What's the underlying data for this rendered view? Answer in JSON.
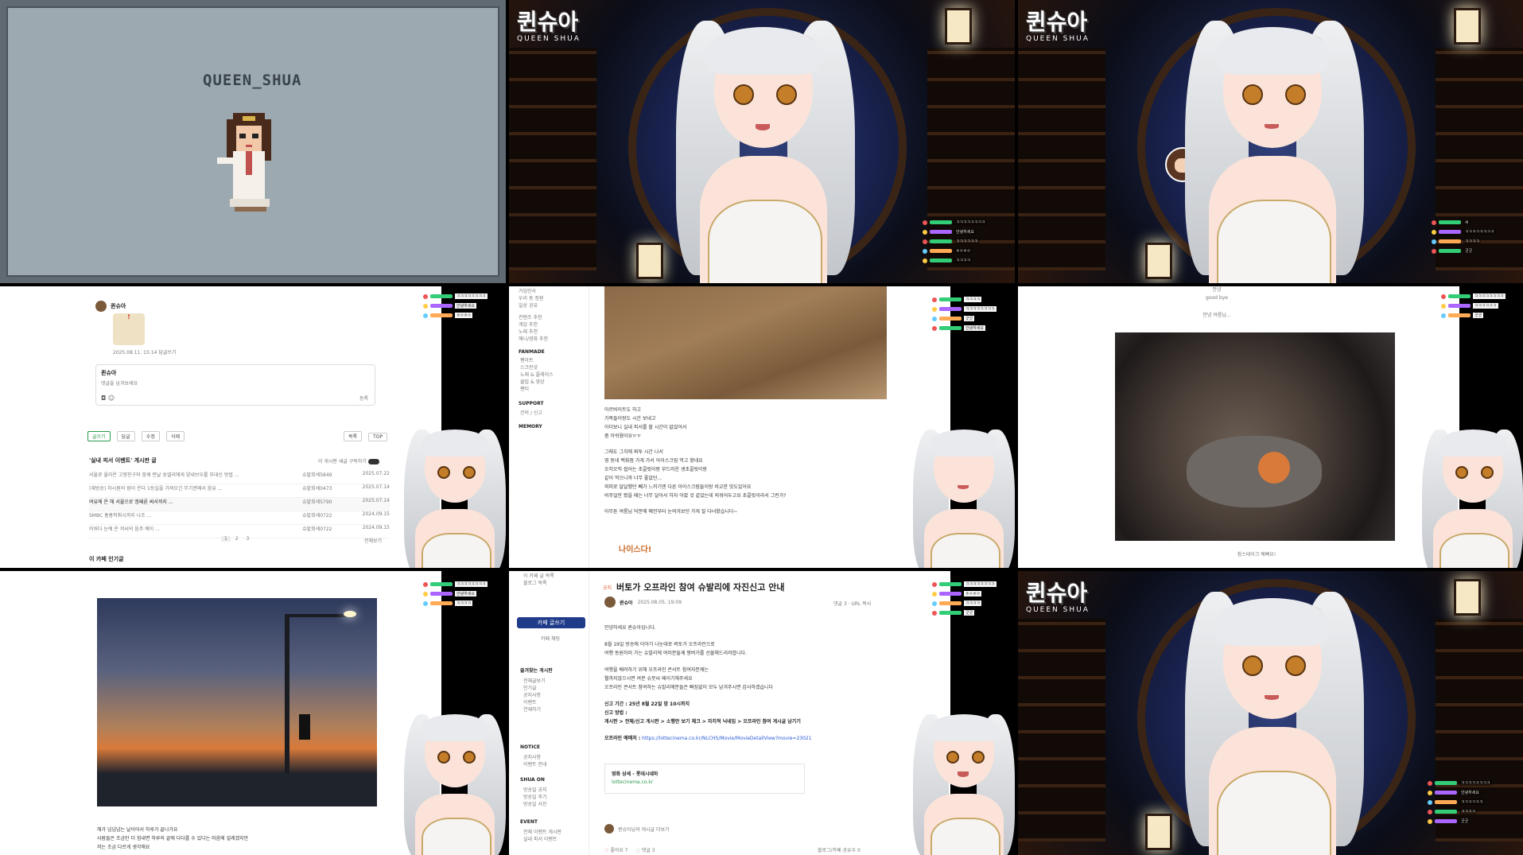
{
  "pixel_tile": {
    "name": "QUEEN_SHUA"
  },
  "stream": {
    "logo_korean": "퀸슈아",
    "logo_english": "QUEEN SHUA"
  },
  "chat_overlay": {
    "messages": [
      "ㅋㅋㅋㅋㅋㅋㅋㅋ",
      "씨",
      "안녕하세요",
      "ㅋㅋㅋㅋㅋㅋ",
      "ㅎㅇㅎㅇ",
      "ㅋㅋㅋㅋ",
      "굿굿"
    ]
  },
  "cafe_post": {
    "commenter": "퀸슈아",
    "comment_date": "2025.08.11. 15:14",
    "reply_label": "답글쓰기",
    "comment_box_name": "퀸슈아",
    "comment_placeholder": "댓글을 남겨보세요",
    "submit_label": "등록",
    "action_buttons": [
      "글쓰기",
      "답글",
      "수정",
      "삭제"
    ],
    "list_button": "목록",
    "top_button": "TOP",
    "board_title": "'실내 피서 이벤트' 게시판 글",
    "board_toggle": "이 게시판 새글 구독하기",
    "popular_title": "이 카페 인기글",
    "posts": [
      {
        "title": "서울로 올라온 고향친구와 함께 찐날 숭엘리에게 양내브우를 부대신 방법 ...",
        "author": "슈밭희세5849",
        "date": "2025.07.22"
      },
      {
        "title": "(재방송) 하시원의 잠이 온다 1등실을 가져오긴 무기권에서 음유 ...",
        "author": "슈밭희세0473",
        "date": "2025.07.14"
      },
      {
        "title": "여유에 온 해 서울으로 엠페론 써서까지 ...",
        "author": "슈밭희세5790",
        "date": "2025.07.14"
      },
      {
        "title": "SMBC 홍홍착취시까지 나조 ...",
        "author": "슈밭희세0722",
        "date": "2024.09.15"
      },
      {
        "title": "미워다 눈에 온 저씨의 음주 예이 ...",
        "author": "슈밭희세0722",
        "date": "2024.09.15"
      }
    ],
    "pages": [
      "1",
      "2",
      "3"
    ],
    "write_label": "전체보기"
  },
  "cafe_text": {
    "menu_top": [
      "가입인사",
      "우리 동 정원",
      "일상 공유"
    ],
    "menu_recommend": [
      "컨텐츠 추천",
      "게임 추천",
      "노래 추천",
      "애니/영화 추천"
    ],
    "fanmade_header": "FANMADE",
    "fanmade_items": [
      "팬아트",
      "스크린샷",
      "노래 & 플레이스",
      "클립 & 영상",
      "팬티"
    ],
    "support_header": "SUPPORT",
    "support_items": [
      "건의 / 신고"
    ],
    "memory_header": "MEMORY",
    "paragraphs": [
      "아르바이트도 하고",
      "가족들이랑도 시간 보내고",
      "아더보니 실내 피서를 할 시간이 없었어서",
      "좀 아쉬웠어요ㅠㅠ",
      "그래도 그치에 짜투 시간 나서",
      "영 동네 백화점 가게 가서 아이스크림 먹고 왔네요",
      "오히오직 씹어는 초콜릿이랑 부드러운 생초콜릿이랑",
      "같이 먹으니까 너무 좋았던...",
      "외피로 달달했던 빼가 느끼기엔 다른 아이스크림들이랑 비교한 맛도있어요",
      "비주얼만 봤을 때는 너무 달아서 하자 아팠 것 같았는데 외워어두고요 초콜릿이라서 그런가?",
      "아무튼 여름님 덕분에 예전부터 눈여겨보던 가게 잘 다녀왔습니다~"
    ],
    "sticker": "나이스다!"
  },
  "cafe_photo": {
    "caption_top": "안녕",
    "caption_top2": "good bye",
    "caption_mid": "안녕 여름님...",
    "caption_bottom": "참스테이크 예뻐요!"
  },
  "cafe_sky": {
    "lines": [
      "해가 넘넘넘는 날이어서 하루가 끝나가요",
      "사람들은 조금만 더 힘내면 하루의 끝에 다다를 수 있다는 마음에 설레겠지만",
      "저는 조금 다르게 생각해요"
    ]
  },
  "cafe_notice": {
    "side_top": [
      "이 카페 글 목록",
      "블로그 목록"
    ],
    "write_button": "카페 글쓰기",
    "chat_button": "카페 채팅",
    "menu_section": "즐겨찾는 게시판",
    "menu_items": [
      "전체글보기",
      "인기글",
      "공지사항",
      "이벤트",
      "연재하기"
    ],
    "notice_header": "NOTICE",
    "notice_items": [
      "공지사항",
      "이벤트 안내"
    ],
    "shua_header": "SHUA ON",
    "shua_items": [
      "방송일 공지",
      "방송일 후기",
      "방송일 사진"
    ],
    "event_header": "EVENT",
    "event_items": [
      "전체 이벤트 게시판",
      "실내 피서 이벤트"
    ],
    "tag": "공지",
    "title": "버토가 오프라인 참여 슈발리에 자진신고 안내",
    "author": "퀸슈아",
    "date": "2025.08.05. 19:09",
    "comment_count": "댓글 3",
    "url_label": "URL 복사",
    "paragraphs": [
      "안녕하세요 퀸슈아입니다.",
      "8월 19일 방송에 이야기 나눈대로 버토가 오프라인으로",
      "여행 동원하러 가는 슈발리에 여러분들께 짱버거를 선물해드리려합니다.",
      "여행을 배려하기 위해 오프라인 콘서트 참여자분께는",
      "뭘까지않으시면 여분 슈뭇씨 왜이기해주세요",
      "오프라인 콘서트 참여하는 슈발리에분들은 빠짐없이 모두 남겨주시면 감사하겠습니다"
    ],
    "deadline": "신고 기간 : 25년 8월 22일 밤 10시까지",
    "method_label": "신고 방법 :",
    "method": "게시판 > 전체/신고 게시판 > 소행안 보기 체크 > 자치적 닉네임 > 오프라인 참여 게시글 남기기",
    "reserve_label": "오프라인 예매처 :",
    "reserve_link": "https://lottecinema.co.kr/NLCHS/Movie/MovieDetailView?movie=23021",
    "card_title": "영화 상세 - 롯데시네마",
    "card_domain": "lottecinema.co.kr",
    "comment_prompt": "퀸슈아님의 게시글 더보기",
    "likes": "좋아요 7",
    "comments_bottom": "댓글 3",
    "footer": "블로그/카페 공유수 0"
  }
}
